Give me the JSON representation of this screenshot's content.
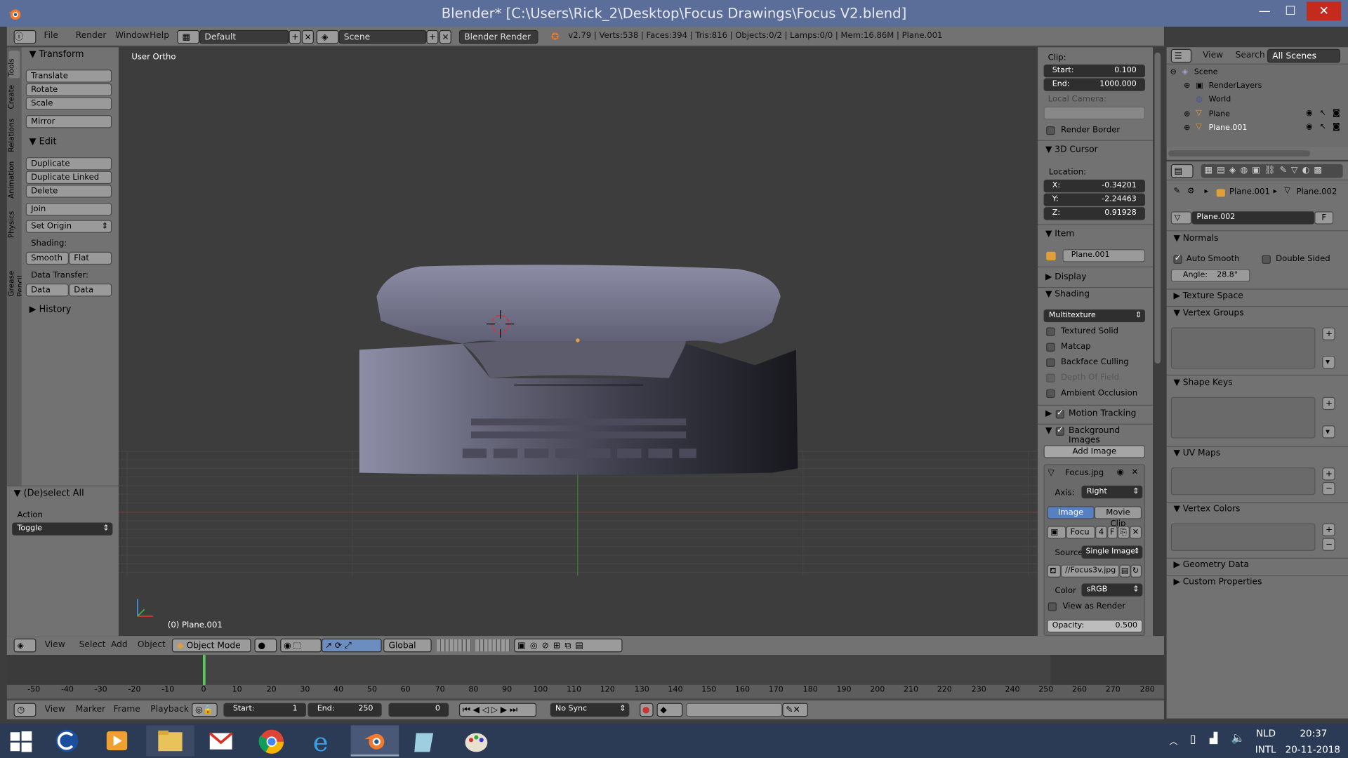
{
  "window": {
    "title": "Blender* [C:\\Users\\Rick_2\\Desktop\\Focus Drawings\\Focus V2.blend]"
  },
  "info_bar": {
    "menus": [
      "File",
      "Render",
      "Window",
      "Help"
    ],
    "layout": "Default",
    "scene": "Scene",
    "engine": "Blender Render",
    "stats": "v2.79 | Verts:538 | Faces:394 | Tris:816 | Objects:0/2 | Lamps:0/0 | Mem:16.86M | Plane.001"
  },
  "tool_tabs": [
    "Tools",
    "Create",
    "Relations",
    "Animation",
    "Physics",
    "Grease Pencil"
  ],
  "toolshelf": {
    "transform_header": "Transform",
    "translate": "Translate",
    "rotate": "Rotate",
    "scale": "Scale",
    "mirror": "Mirror",
    "edit_header": "Edit",
    "duplicate": "Duplicate",
    "duplicate_linked": "Duplicate Linked",
    "delete": "Delete",
    "join": "Join",
    "set_origin": "Set Origin",
    "shading_label": "Shading:",
    "smooth": "Smooth",
    "flat": "Flat",
    "data_transfer_label": "Data Transfer:",
    "data": "Data",
    "data_layo": "Data Layo",
    "history_header": "History",
    "op_header": "(De)select All",
    "action_label": "Action",
    "action_value": "Toggle"
  },
  "viewport": {
    "view_label": "User Ortho",
    "object_label": "(0) Plane.001"
  },
  "n_panel": {
    "clip_label": "Clip:",
    "start_label": "Start:",
    "start_value": "0.100",
    "end_label": "End:",
    "end_value": "1000.000",
    "local_camera": "Local Camera:",
    "render_border": "Render Border",
    "cursor_header": "3D Cursor",
    "location_label": "Location:",
    "x_label": "X:",
    "x_value": "-0.34201",
    "y_label": "Y:",
    "y_value": "-2.24463",
    "z_label": "Z:",
    "z_value": "0.91928",
    "item_header": "Item",
    "item_name": "Plane.001",
    "display_header": "Display",
    "shading_header": "Shading",
    "shading_mode": "Multitexture",
    "textured_solid": "Textured Solid",
    "matcap": "Matcap",
    "backface_culling": "Backface Culling",
    "depth_of_field": "Depth Of Field",
    "ambient_occlusion": "Ambient Occlusion",
    "motion_tracking": "Motion Tracking",
    "background_images": "Background Images",
    "add_image": "Add Image",
    "bg_name": "Focus.jpg",
    "axis_label": "Axis:",
    "axis_value": "Right",
    "image_tab": "Image",
    "movie_tab": "Movie Clip",
    "img_field": "Focu",
    "img_users": "4",
    "img_f": "F",
    "source_label": "Source",
    "source_value": "Single Image",
    "path": "//Focus3v.jpg",
    "color_label": "Color",
    "color_value": "sRGB",
    "view_as_render": "View as Render",
    "opacity_label": "Opacity:",
    "opacity_value": "0.500"
  },
  "outliner": {
    "view": "View",
    "search": "Search",
    "all_scenes": "All Scenes",
    "items": [
      "Scene",
      "RenderLayers",
      "World",
      "Plane",
      "Plane.001"
    ]
  },
  "properties": {
    "breadcrumb_obj": "Plane.001",
    "breadcrumb_mesh": "Plane.002",
    "mesh_name": "Plane.002",
    "f": "F",
    "normals": "Normals",
    "auto_smooth": "Auto Smooth",
    "double_sided": "Double Sided",
    "angle_label": "Angle:",
    "angle_value": "28.8°",
    "texture_space": "Texture Space",
    "vertex_groups": "Vertex Groups",
    "shape_keys": "Shape Keys",
    "uv_maps": "UV Maps",
    "vertex_colors": "Vertex Colors",
    "geometry_data": "Geometry Data",
    "custom_properties": "Custom Properties"
  },
  "view3d_header": {
    "menus": [
      "View",
      "Select",
      "Add",
      "Object"
    ],
    "mode": "Object Mode",
    "orientation": "Global"
  },
  "timeline": {
    "ticks": [
      "-50",
      "-40",
      "-30",
      "-20",
      "-10",
      "0",
      "10",
      "20",
      "30",
      "40",
      "50",
      "60",
      "70",
      "80",
      "90",
      "100",
      "110",
      "120",
      "130",
      "140",
      "150",
      "160",
      "170",
      "180",
      "190",
      "200",
      "210",
      "220",
      "230",
      "240",
      "250",
      "260",
      "270",
      "280"
    ],
    "menus": [
      "View",
      "Marker",
      "Frame",
      "Playback"
    ],
    "start_label": "Start:",
    "start_value": "1",
    "end_label": "End:",
    "end_value": "250",
    "current": "0",
    "sync": "No Sync"
  },
  "tray": {
    "lang1": "NLD",
    "lang2": "INTL",
    "time": "20:37",
    "date": "20-11-2018"
  }
}
